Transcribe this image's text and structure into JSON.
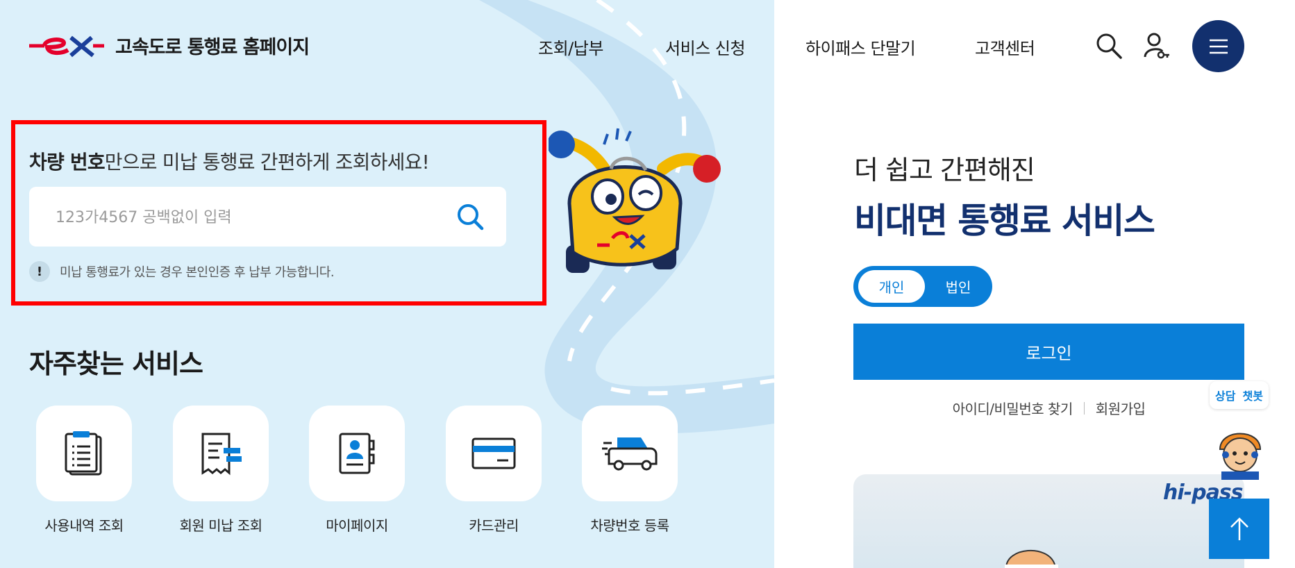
{
  "header": {
    "logo_text": "ex",
    "site_title": "고속도로 통행료 홈페이지",
    "nav": [
      {
        "label": "조회/납부"
      },
      {
        "label": "서비스 신청"
      },
      {
        "label": "하이패스 단말기"
      },
      {
        "label": "고객센터"
      }
    ],
    "icons": [
      "search-icon",
      "user-key-icon",
      "hamburger-menu-icon"
    ]
  },
  "search": {
    "headline_bold": "차량 번호",
    "headline_rest": "만으로 미납 통행료 간편하게 조회하세요!",
    "placeholder": "123가4567 공백없이 입력",
    "value": "",
    "notice_badge": "!",
    "notice": "미납 통행료가 있는 경우 본인인증 후 납부 가능합니다."
  },
  "services": {
    "title": "자주찾는 서비스",
    "items": [
      {
        "label": "사용내역 조회",
        "icon": "clipboard-list-icon"
      },
      {
        "label": "회원 미납 조회",
        "icon": "receipt-icon"
      },
      {
        "label": "마이페이지",
        "icon": "profile-book-icon"
      },
      {
        "label": "카드관리",
        "icon": "credit-card-icon"
      },
      {
        "label": "차량번호 등록",
        "icon": "car-icon"
      }
    ]
  },
  "login_panel": {
    "subtitle": "더 쉽고 간편해진",
    "title": "비대면 통행료 서비스",
    "toggle": {
      "personal": "개인",
      "corporate": "법인",
      "selected": "personal"
    },
    "login_label": "로그인",
    "find_label": "아이디/비밀번호 찾기",
    "join_label": "회원가입"
  },
  "banner": {
    "brand": "hi-pass"
  },
  "chatbot": {
    "left": "상담",
    "right": "챗봇"
  },
  "colors": {
    "navy": "#12306e",
    "blue": "#0a7fd8",
    "left_bg": "#dcf0fa",
    "highlight_border": "#ff0000"
  }
}
